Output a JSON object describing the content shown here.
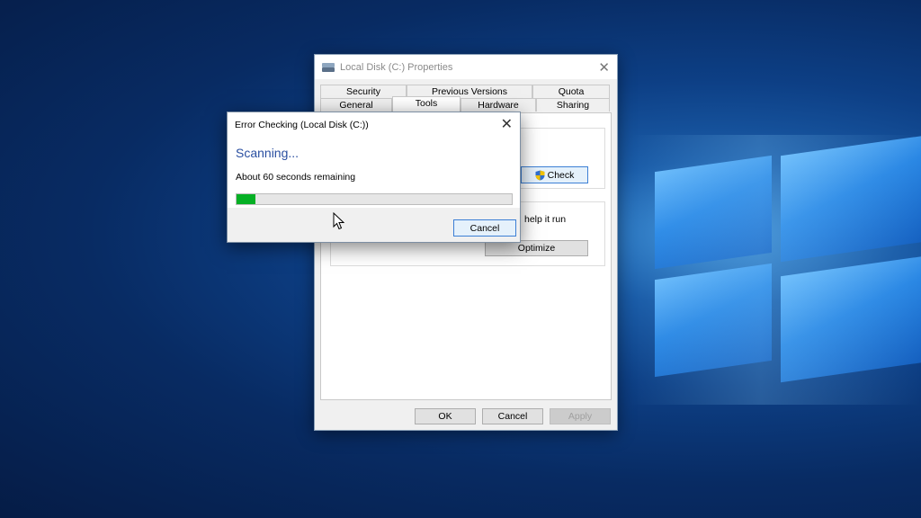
{
  "properties_window": {
    "title": "Local Disk (C:) Properties",
    "tabs_row1": [
      "Security",
      "Previous Versions",
      "Quota"
    ],
    "tabs_row2": [
      "General",
      "Tools",
      "Hardware",
      "Sharing"
    ],
    "active_tab": "Tools",
    "check_label": "Check",
    "help_text": "help it run",
    "optimize_label": "Optimize",
    "ok_label": "OK",
    "cancel_label": "Cancel",
    "apply_label": "Apply"
  },
  "error_dialog": {
    "title": "Error Checking (Local Disk (C:))",
    "status": "Scanning...",
    "remaining": "About 60 seconds remaining",
    "progress_percent": 7,
    "cancel_label": "Cancel"
  },
  "colors": {
    "progress_fill": "#06b025",
    "accent": "#2a4fa1"
  },
  "icons": {
    "window_icon": "drive-icon",
    "check_icon": "shield-icon",
    "pointer": "cursor-icon"
  }
}
